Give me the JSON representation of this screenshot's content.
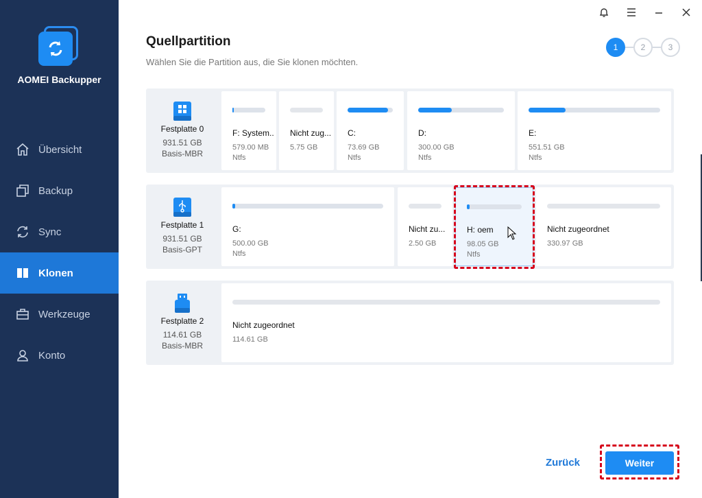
{
  "app": {
    "name": "AOMEI Backupper"
  },
  "nav": {
    "items": [
      {
        "label": "Übersicht",
        "icon": "home-icon",
        "active": false
      },
      {
        "label": "Backup",
        "icon": "backup-icon",
        "active": false
      },
      {
        "label": "Sync",
        "icon": "sync-icon",
        "active": false
      },
      {
        "label": "Klonen",
        "icon": "clone-icon",
        "active": true
      },
      {
        "label": "Werkzeuge",
        "icon": "toolbox-icon",
        "active": false
      },
      {
        "label": "Konto",
        "icon": "user-icon",
        "active": false
      }
    ]
  },
  "titlebar": {
    "icons": [
      "bell-icon",
      "menu-icon",
      "minimize-icon",
      "close-icon"
    ]
  },
  "header": {
    "title": "Quellpartition",
    "subtitle": "Wählen Sie die Partition aus, die Sie klonen möchten."
  },
  "steps": [
    "1",
    "2",
    "3"
  ],
  "active_step": 1,
  "disks": [
    {
      "name": "Festplatte 0",
      "size": "931.51 GB",
      "type": "Basis-MBR",
      "icon": "windows-disk-icon",
      "partitions": [
        {
          "name": "F: System...",
          "size": "579.00 MB",
          "fs": "Ntfs",
          "used": 0.05
        },
        {
          "name": "Nicht zug...",
          "size": "5.75 GB",
          "fs": "",
          "used": 0,
          "unallocated": true
        },
        {
          "name": "C:",
          "size": "73.69 GB",
          "fs": "Ntfs",
          "used": 0.9
        },
        {
          "name": "D:",
          "size": "300.00 GB",
          "fs": "Ntfs",
          "used": 0.39
        },
        {
          "name": "E:",
          "size": "551.51 GB",
          "fs": "Ntfs",
          "used": 0.28
        }
      ]
    },
    {
      "name": "Festplatte 1",
      "size": "931.51 GB",
      "type": "Basis-GPT",
      "icon": "usb-disk-icon",
      "partitions": [
        {
          "name": "G:",
          "size": "500.00 GB",
          "fs": "Ntfs",
          "used": 0.01
        },
        {
          "name": "Nicht zu...",
          "size": "2.50 GB",
          "fs": "",
          "used": 0,
          "unallocated": true
        },
        {
          "name": "H: oem",
          "size": "98.05 GB",
          "fs": "Ntfs",
          "used": 0.05,
          "selected": true
        },
        {
          "name": "Nicht zugeordnet",
          "size": "330.97 GB",
          "fs": "",
          "used": 0,
          "unallocated": true
        }
      ]
    },
    {
      "name": "Festplatte 2",
      "size": "114.61 GB",
      "type": "Basis-MBR",
      "icon": "usb-stick-icon",
      "partitions": [
        {
          "name": "Nicht zugeordnet",
          "size": "114.61 GB",
          "fs": "",
          "used": 0,
          "unallocated": true
        }
      ]
    }
  ],
  "footer": {
    "back_label": "Zurück",
    "next_label": "Weiter"
  },
  "colors": {
    "accent": "#1e8cf3",
    "sidebar": "#1c3257",
    "highlight": "#d6001c"
  }
}
